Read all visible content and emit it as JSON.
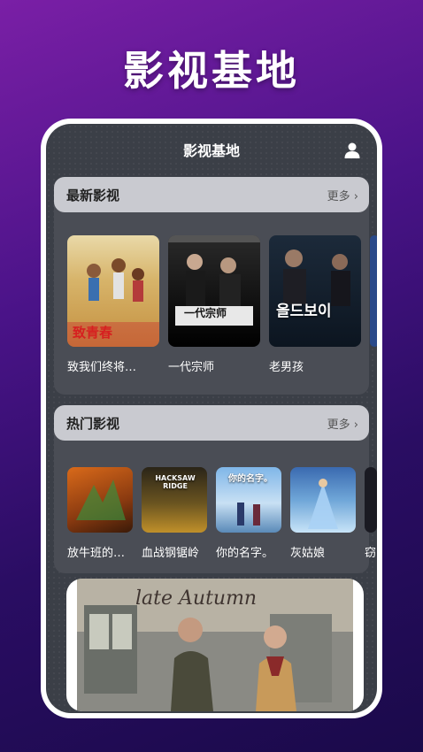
{
  "promo": {
    "title": "影视基地"
  },
  "app": {
    "title": "影视基地"
  },
  "latest": {
    "label": "最新影视",
    "more": "更多 ›",
    "items": [
      {
        "title": "致我们终将…",
        "poster_text": "致青春"
      },
      {
        "title": "一代宗师",
        "poster_text": "一代宗师"
      },
      {
        "title": "老男孩",
        "poster_text": "올드보이"
      }
    ]
  },
  "hot": {
    "label": "热门影视",
    "more": "更多 ›",
    "items": [
      {
        "title": "放牛班的…"
      },
      {
        "title": "血战钢锯岭",
        "poster_text": "HACKSAW RIDGE"
      },
      {
        "title": "你的名字。",
        "poster_text": "你的名字。"
      },
      {
        "title": "灰姑娘"
      },
      {
        "title": "窃"
      }
    ]
  },
  "banner": {
    "script_text": "late Autumn"
  }
}
